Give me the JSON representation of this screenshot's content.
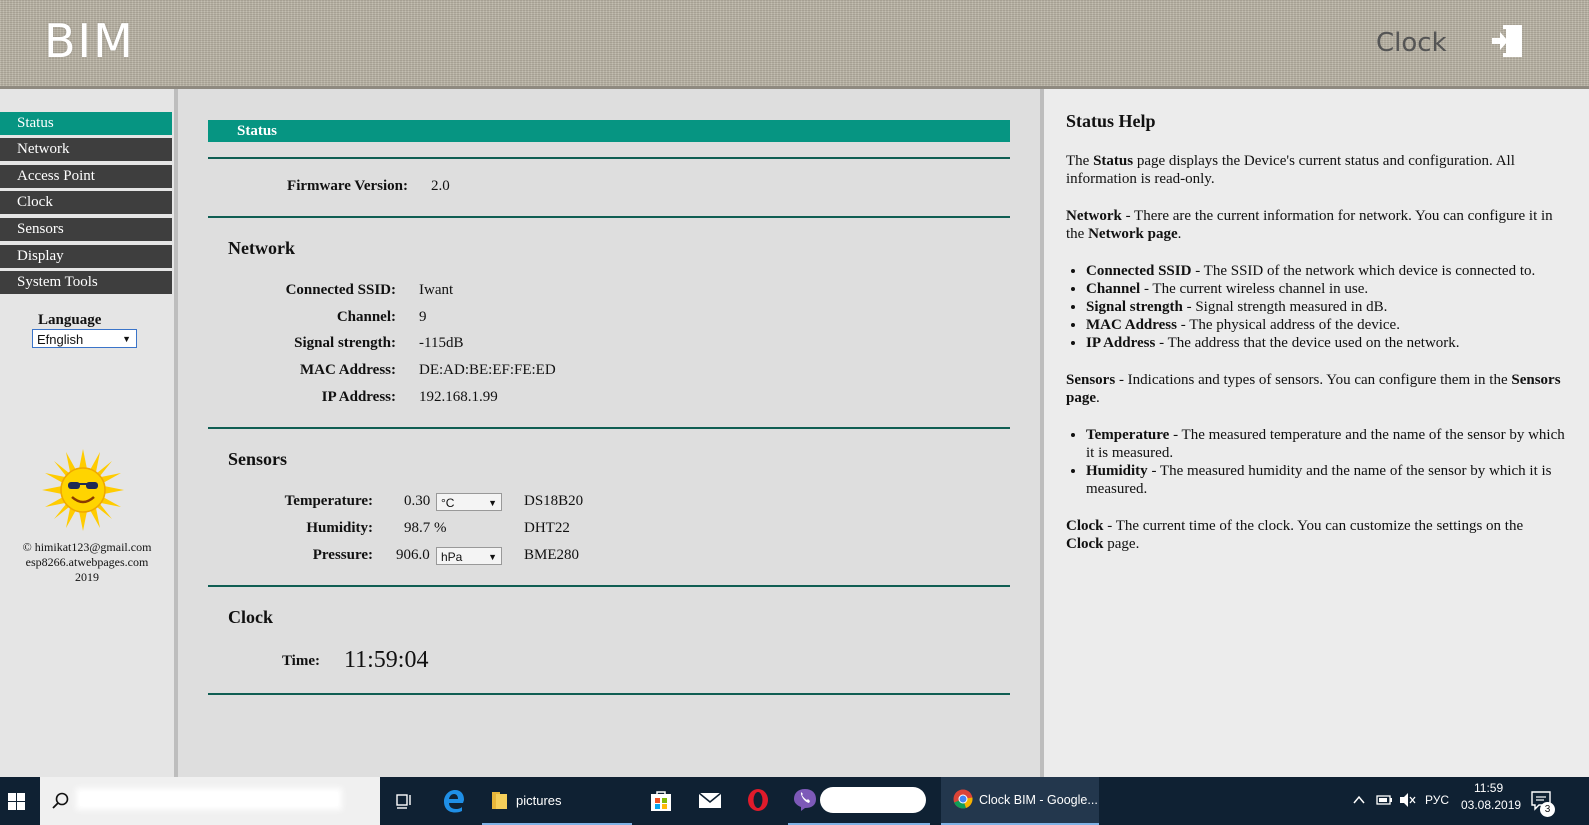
{
  "header": {
    "logo": "BIM",
    "page_title": "Clock",
    "logout_icon": "logout-icon"
  },
  "sidebar": {
    "items": [
      {
        "label": "Status",
        "active": true
      },
      {
        "label": "Network",
        "active": false
      },
      {
        "label": "Access Point",
        "active": false
      },
      {
        "label": "Clock",
        "active": false
      },
      {
        "label": "Sensors",
        "active": false
      },
      {
        "label": "Display",
        "active": false
      },
      {
        "label": "System Tools",
        "active": false
      }
    ],
    "language_label": "Language",
    "language_value": "Efnglish",
    "copyright_line1": "© himikat123@gmail.com",
    "copyright_line2": "esp8266.atwebpages.com",
    "copyright_line3": "2019"
  },
  "main": {
    "status_header": "Status",
    "firmware": {
      "label": "Firmware Version:",
      "value": "2.0"
    },
    "network": {
      "title": "Network",
      "rows": [
        {
          "label": "Connected SSID:",
          "value": "Iwant"
        },
        {
          "label": "Channel:",
          "value": "9"
        },
        {
          "label": "Signal strength:",
          "value": "-115dB"
        },
        {
          "label": "MAC Address:",
          "value": "DE:AD:BE:EF:FE:ED"
        },
        {
          "label": "IP Address:",
          "value": "192.168.1.99"
        }
      ]
    },
    "sensors": {
      "title": "Sensors",
      "rows": [
        {
          "label": "Temperature:",
          "value": "0.30",
          "unit": "°C",
          "sensor": "DS18B20"
        },
        {
          "label": "Humidity:",
          "value": "98.7 %",
          "unit": "",
          "sensor": "DHT22"
        },
        {
          "label": "Pressure:",
          "value": "906.0",
          "unit": "hPa",
          "sensor": "BME280"
        }
      ]
    },
    "clock": {
      "title": "Clock",
      "time_label": "Time:",
      "time_value": "11:59:04"
    }
  },
  "help": {
    "title": "Status Help",
    "p1_a": "The ",
    "p1_b": "Status",
    "p1_c": " page displays the Device's current status and configuration. All information is read-only.",
    "p2_a": "Network",
    "p2_b": " - There are the current information for network. You can configure it in the ",
    "p2_c": "Network page",
    "p2_d": ".",
    "list1": [
      {
        "term": "Connected SSID",
        "desc": " - The SSID of the network which device is connected to."
      },
      {
        "term": "Channel",
        "desc": " - The current wireless channel in use."
      },
      {
        "term": "Signal strength",
        "desc": " - Signal strength measured in dB."
      },
      {
        "term": "MAC Address",
        "desc": " - The physical address of the device."
      },
      {
        "term": "IP Address",
        "desc": " - The address that the device used on the network."
      }
    ],
    "p3_a": "Sensors",
    "p3_b": " - Indications and types of sensors. You can configure them in the ",
    "p3_c": "Sensors page",
    "p3_d": ".",
    "list2": [
      {
        "term": "Temperature",
        "desc": " - The measured temperature and the name of the sensor by which it is measured."
      },
      {
        "term": "Humidity",
        "desc": " - The measured humidity and the name of the sensor by which it is measured."
      }
    ],
    "p4_a": "Clock",
    "p4_b": " - The current time of the clock. You can customize the settings on the ",
    "p4_c": "Clock",
    "p4_d": " page."
  },
  "taskbar": {
    "explorer_label": "pictures",
    "chrome_label": "Clock BIM - Google...",
    "lang": "РУС",
    "time": "11:59",
    "date": "03.08.2019",
    "notification_count": "3"
  },
  "colors": {
    "accent": "#069582",
    "nav_bg": "#3e3e3e",
    "divider": "#0f5e53",
    "taskbar": "#0f2133"
  }
}
